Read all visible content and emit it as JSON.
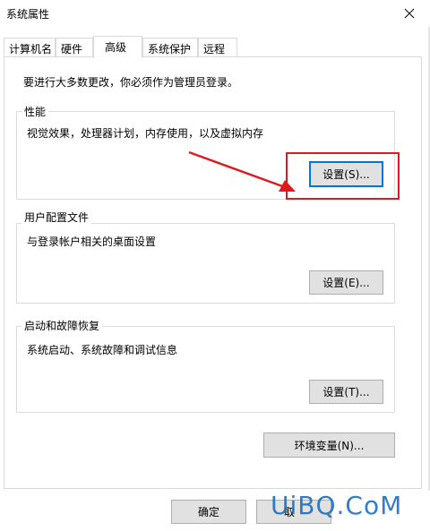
{
  "window": {
    "title": "系统属性"
  },
  "tabs": [
    {
      "label": "计算机名"
    },
    {
      "label": "硬件"
    },
    {
      "label": "高级"
    },
    {
      "label": "系统保护"
    },
    {
      "label": "远程"
    }
  ],
  "notice": "要进行大多数更改，你必须作为管理员登录。",
  "performance": {
    "label": "性能",
    "desc": "视觉效果，处理器计划，内存使用，以及虚拟内存",
    "button": "设置(S)..."
  },
  "profiles": {
    "label": "用户配置文件",
    "desc": "与登录帐户相关的桌面设置",
    "button": "设置(E)..."
  },
  "startup": {
    "label": "启动和故障恢复",
    "desc": "系统启动、系统故障和调试信息",
    "button": "设置(T)..."
  },
  "env_button": "环境变量(N)...",
  "footer": {
    "ok": "确定",
    "cancel": "取"
  },
  "watermark": "UiBQ.CoM",
  "colors": {
    "annotation_red": "#e0191f",
    "focus_blue": "#0078d7"
  },
  "icons": {
    "close": "close-icon"
  }
}
